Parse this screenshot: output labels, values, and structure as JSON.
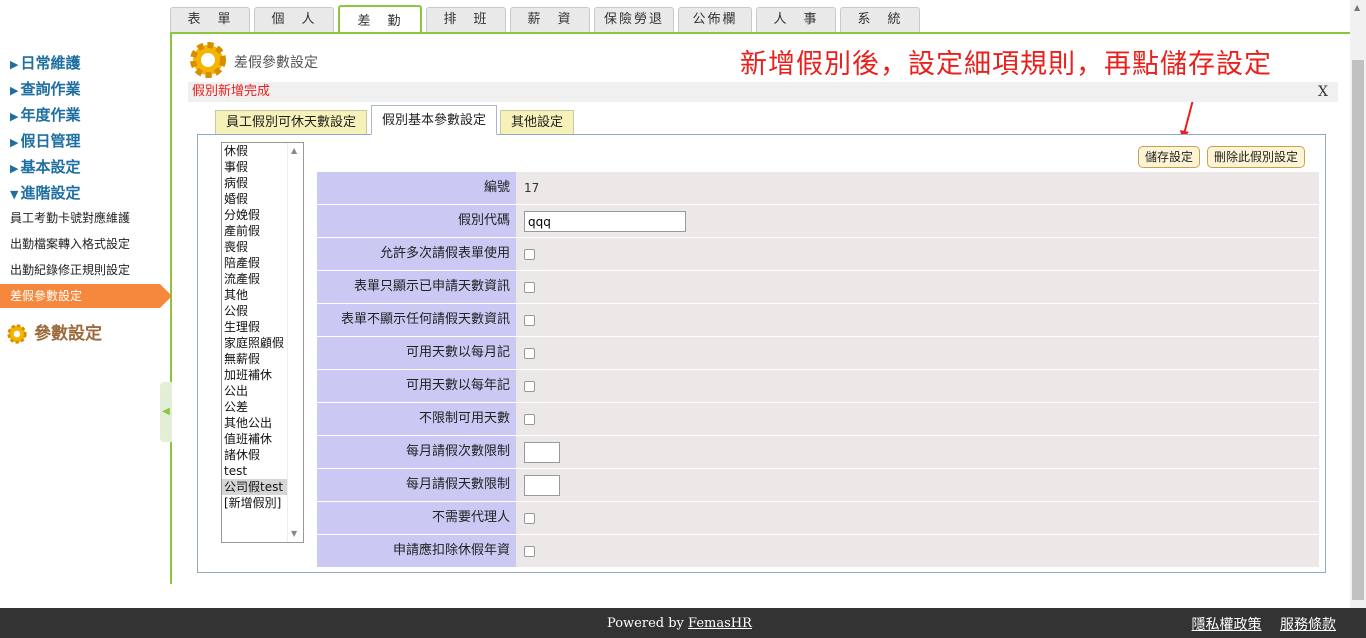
{
  "top_tabs": [
    "表　單",
    "個　人",
    "差　勤",
    "排　班",
    "薪　資",
    "保險勞退",
    "公佈欄",
    "人　事",
    "系　統"
  ],
  "sidebar": {
    "menus": [
      "日常維護",
      "查詢作業",
      "年度作業",
      "假日管理",
      "基本設定",
      "進階設定"
    ],
    "submenus": [
      "員工考勤卡號對應維護",
      "出勤檔案轉入格式設定",
      "出勤紀錄修正規則設定",
      "差假參數設定"
    ],
    "param_section": "參數設定"
  },
  "page": {
    "title": "差假參數設定",
    "annotation": "新增假別後，設定細項規則，再點儲存設定",
    "message": "假別新增完成",
    "close": "X"
  },
  "inner_tabs": [
    "員工假別可休天數設定",
    "假別基本參數設定",
    "其他設定"
  ],
  "leave_types": [
    "休假",
    "事假",
    "病假",
    "婚假",
    "分娩假",
    "產前假",
    "喪假",
    "陪產假",
    "流產假",
    "其他",
    "公假",
    "生理假",
    "家庭照顧假",
    "無薪假",
    "加班補休",
    "公出",
    "公差",
    "其他公出",
    "值班補休",
    "諸休假",
    "test",
    "公司假test",
    "[新增假別]"
  ],
  "selected_leave": "公司假test",
  "buttons": {
    "save": "儲存設定",
    "delete": "刪除此假別設定"
  },
  "form": {
    "number_label": "編號",
    "number_value": "17",
    "code_label": "假別代碼",
    "code_value": "qqq",
    "checks": {
      "multi_use": "允許多次請假表單使用",
      "show_applied": "表單只顯示已申請天數資訊",
      "hide_all": "表單不顯示任何請假天數資訊",
      "monthly": "可用天數以每月記",
      "yearly": "可用天數以每年記",
      "unlimited": "不限制可用天數"
    },
    "monthly_count_label": "每月請假次數限制",
    "monthly_days_label": "每月請假天數限制",
    "no_agent": "不需要代理人",
    "deduct_annual": "申請應扣除休假年資"
  },
  "footer": {
    "powered_prefix": "Powered by ",
    "brand": "FemasHR",
    "privacy": "隱私權政策",
    "terms": "服務條款"
  },
  "colors": {
    "accent": "#8cc63f",
    "active_menu": "#f5883c",
    "label_bg": "#c9c9f4",
    "annotation": "#e8211c"
  }
}
